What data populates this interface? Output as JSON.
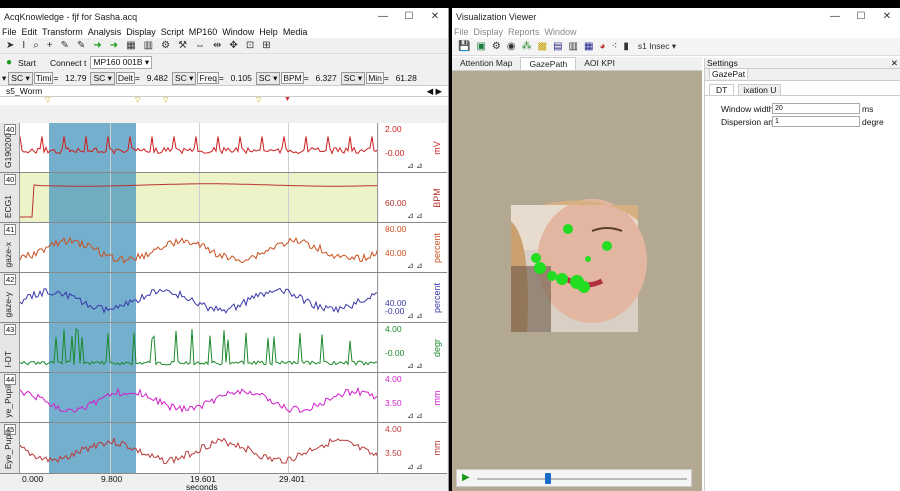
{
  "acq": {
    "title": "AcqKnowledge - fjf for Sasha.acq",
    "menu": [
      "File",
      "Edit",
      "Transform",
      "Analysis",
      "Display",
      "Script",
      "MP160",
      "Window",
      "Help",
      "Media"
    ],
    "start_label": "Start",
    "connect_label": "Connect t",
    "device": "MP160 001B",
    "measures": [
      {
        "ch": "SC",
        "name": "Timi",
        "value": "12.79"
      },
      {
        "ch": "SC",
        "name": "Delt",
        "value": "9.482"
      },
      {
        "ch": "SC",
        "name": "Freq",
        "value": "0.105"
      },
      {
        "ch": "SC",
        "name": "BPM",
        "value": "6.327"
      },
      {
        "ch": "SC",
        "name": "Min",
        "value": "61.28"
      }
    ],
    "marker_label": "s5_Worm",
    "channels": [
      {
        "num": "40",
        "name": "G190200",
        "hi": "2.00",
        "lo": "-0.00",
        "unit": "mV",
        "color": "#cc1f1f",
        "bg": "#ffffff"
      },
      {
        "num": "40",
        "name": "ECG1",
        "hi": "",
        "lo": "60.00",
        "unit": "BPM",
        "color": "#b8322b",
        "bg": "#eef2c8"
      },
      {
        "num": "41",
        "name": "gaze-x",
        "hi": "80.00",
        "lo": "40.00",
        "unit": "percent",
        "color": "#c8501e",
        "bg": "#ffffff"
      },
      {
        "num": "42",
        "name": "gaze-y",
        "hi": "",
        "lo": "40.00",
        "lo2": "-0.00",
        "unit": "percent",
        "color": "#3838a8",
        "bg": "#ffffff"
      },
      {
        "num": "43",
        "name": "I-DT",
        "hi": "4.00",
        "lo": "-0.00",
        "unit": "degr",
        "color": "#1c8a2c",
        "bg": "#ffffff"
      },
      {
        "num": "44",
        "name": "ye_Pupil",
        "hi": "4.00",
        "lo": "3.50",
        "unit": "mm",
        "color": "#d01ec8",
        "bg": "#ffffff"
      },
      {
        "num": "45",
        "name": "Eye_Pupil",
        "hi": "4.00",
        "lo": "3.50",
        "unit": "mm",
        "color": "#b83a3a",
        "bg": "#ffffff"
      }
    ],
    "time_ticks": [
      "0.000",
      "9.800",
      "19.601",
      "29.401"
    ],
    "time_unit": "seconds"
  },
  "viz": {
    "title": "Visualization Viewer",
    "menu": [
      "File",
      "Display",
      "Reports",
      "Window"
    ],
    "scene_label": "s1",
    "scene_unit": "Insec",
    "tabs": [
      "Attention Map",
      "GazePath",
      "AOI KPI"
    ],
    "active_tab": "GazePath",
    "settings_title": "Settings",
    "settings_section": "GazePat",
    "settings_tabs": [
      "DT",
      "ixation U"
    ],
    "window_width_label": "Window width",
    "window_width_value": "20",
    "window_width_unit": "ms",
    "dispersion_label": "Dispersion an",
    "dispersion_value": "1",
    "dispersion_unit": "degre"
  }
}
